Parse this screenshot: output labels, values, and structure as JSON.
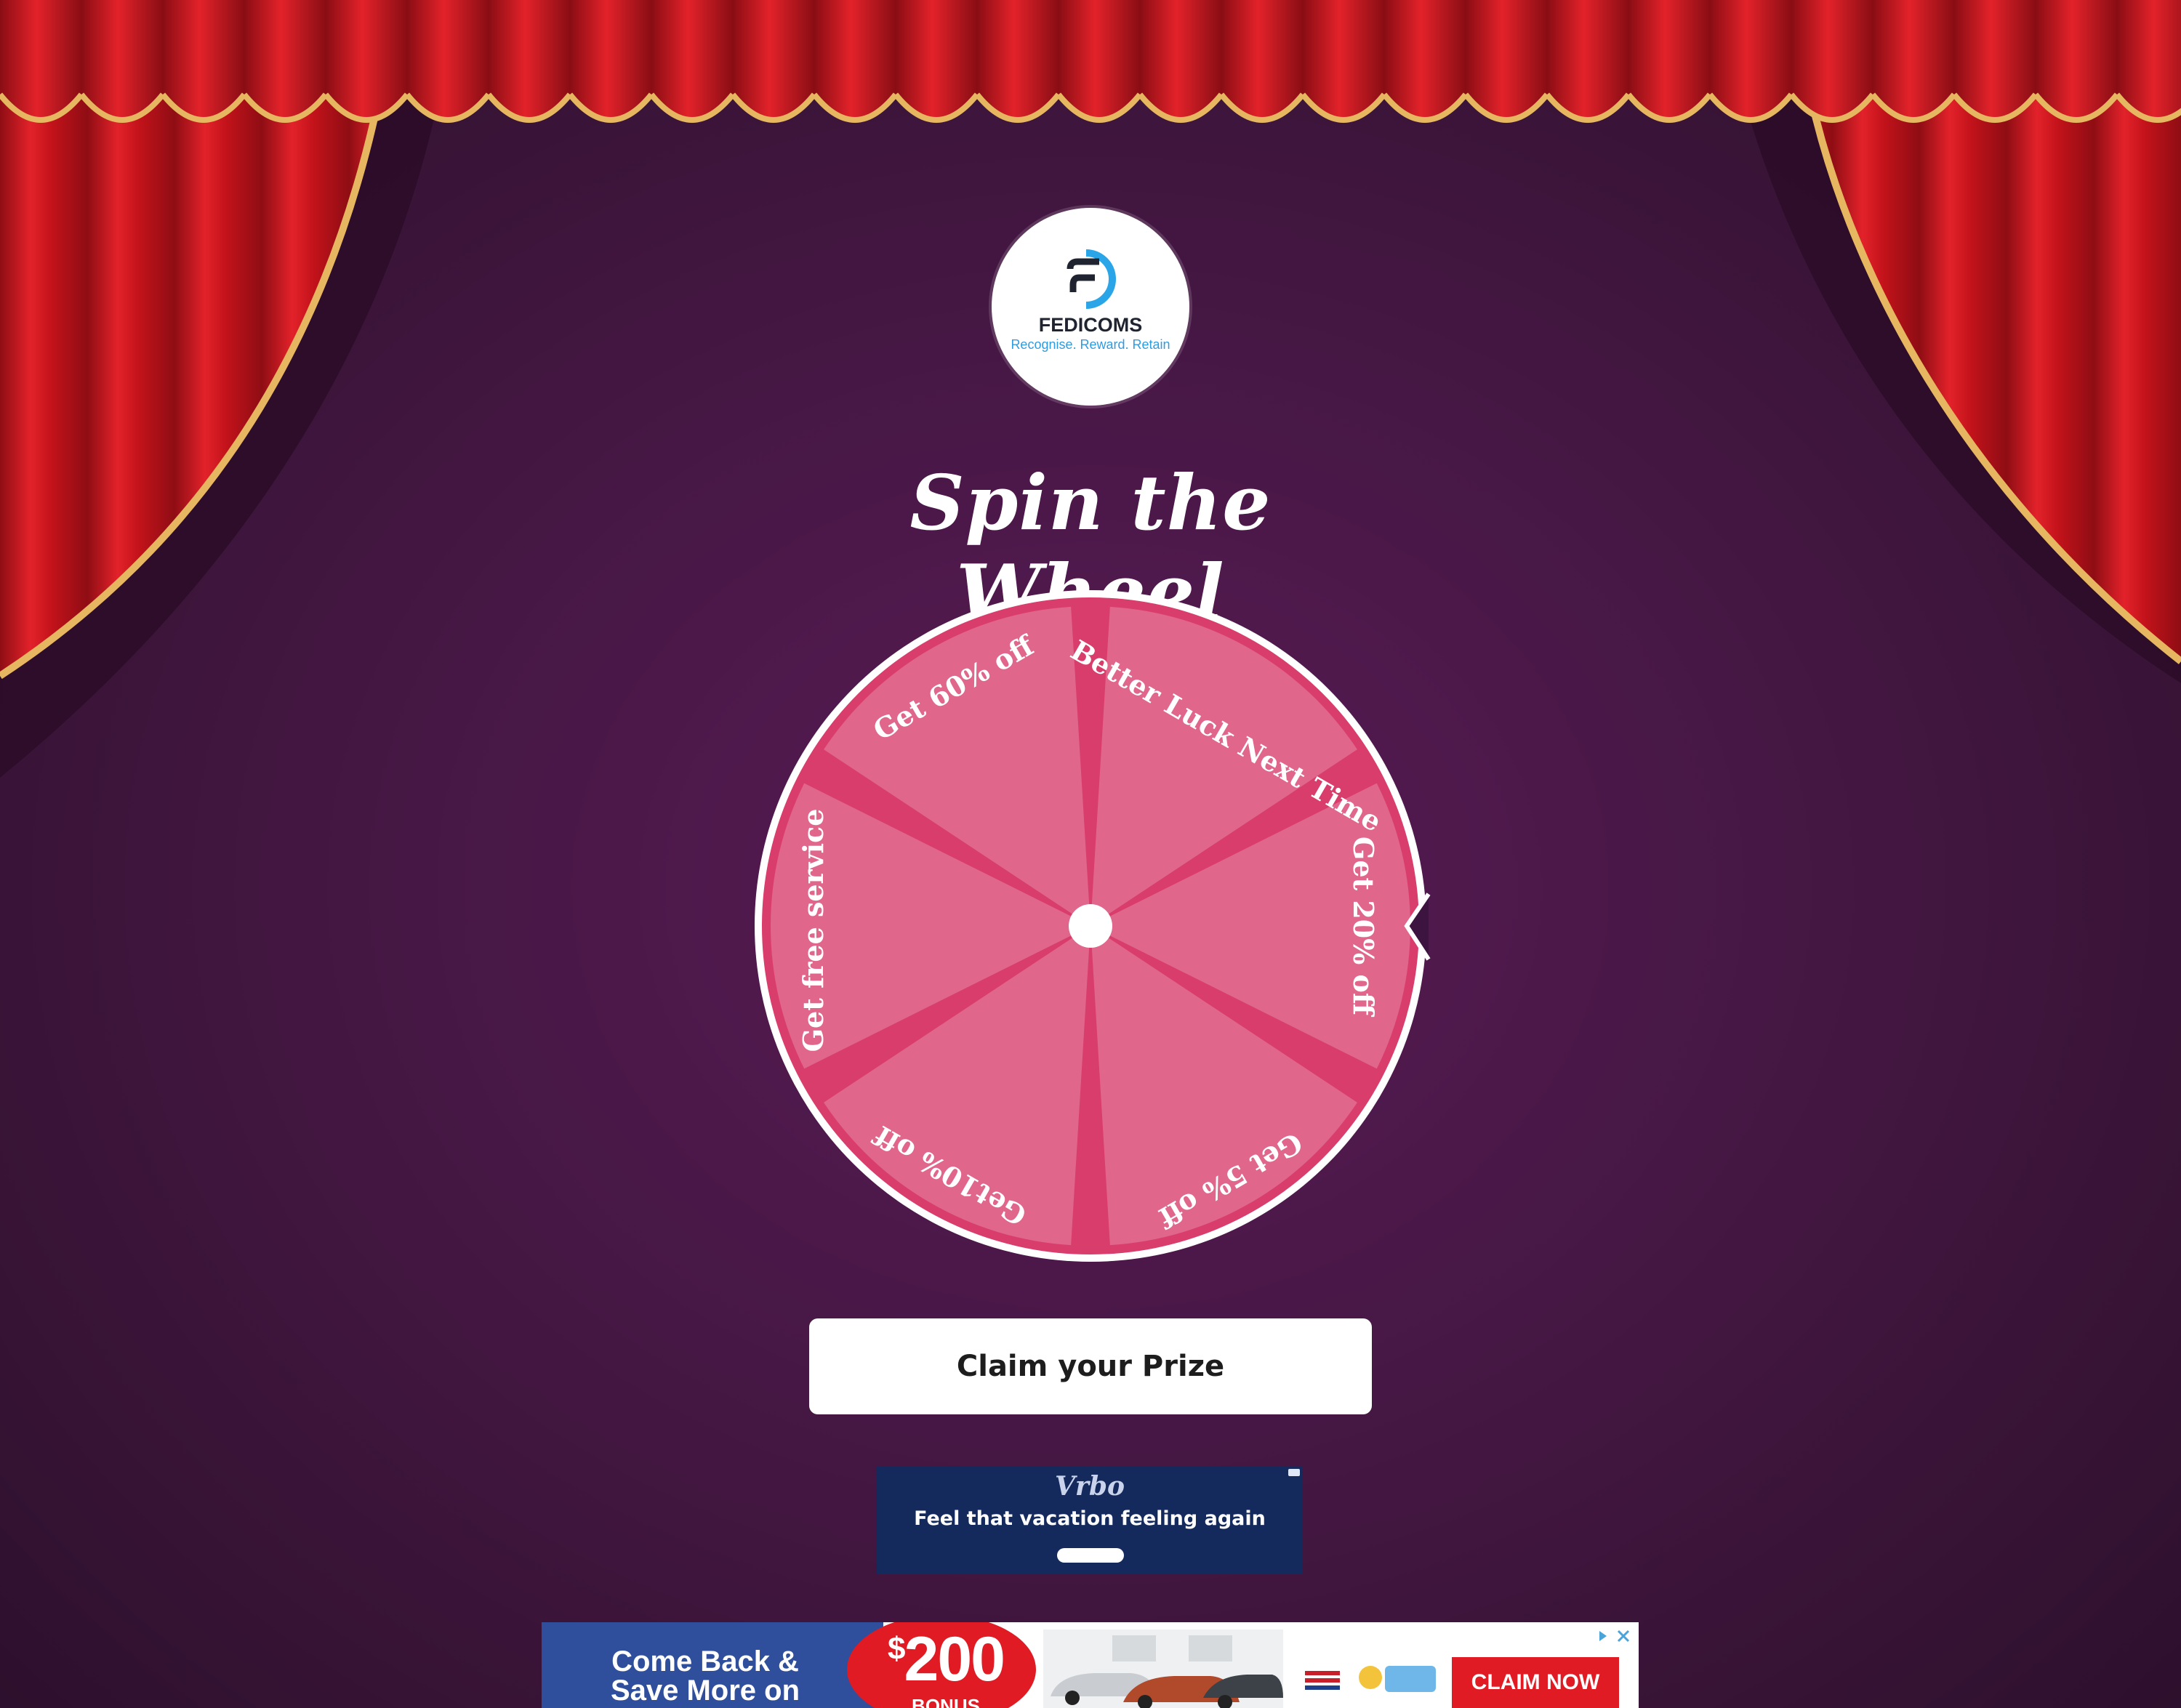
{
  "logo": {
    "name": "FEDICOMS",
    "tagline": "Recognise. Reward. Retain"
  },
  "title": "Spin the Wheel",
  "wheel": {
    "segments": [
      {
        "label": "Better Luck Next Time"
      },
      {
        "label": "Get 20% off"
      },
      {
        "label": "Get 5% off"
      },
      {
        "label": "Get10% off"
      },
      {
        "label": "Get free  service"
      },
      {
        "label": "Get 60% off"
      }
    ]
  },
  "claim_button": {
    "label": "Claim your Prize"
  },
  "ads": {
    "vrbo": {
      "brand": "Vrbo",
      "headline": "Feel that vacation feeling again"
    },
    "bottom": {
      "headline_line1": "Come Back &",
      "headline_line2": "Save More on",
      "amount": "200",
      "currency": "$",
      "bonus": "BONUS",
      "cta": "CLAIM NOW"
    }
  },
  "colors": {
    "curtain_red": "#d4141c",
    "curtain_gold": "#e6b760",
    "wheel_segment": "#e0668c",
    "wheel_divider": "#d93d6c",
    "background": "#4a1848"
  }
}
